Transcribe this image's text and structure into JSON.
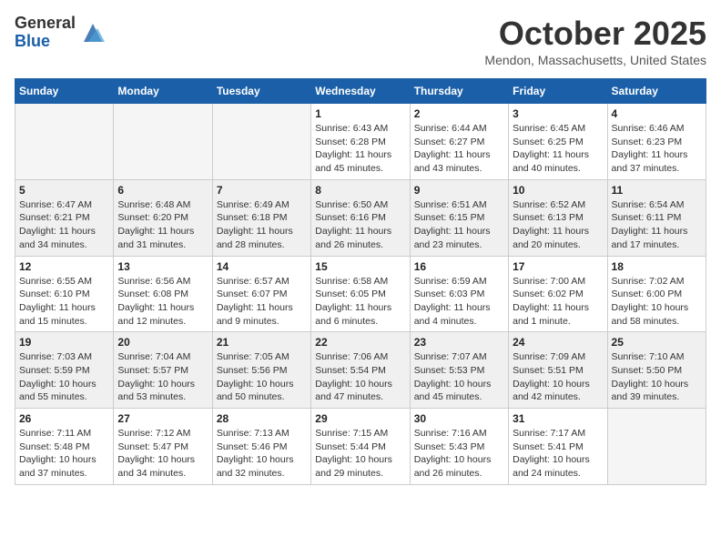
{
  "logo": {
    "general": "General",
    "blue": "Blue"
  },
  "title": "October 2025",
  "location": "Mendon, Massachusetts, United States",
  "weekdays": [
    "Sunday",
    "Monday",
    "Tuesday",
    "Wednesday",
    "Thursday",
    "Friday",
    "Saturday"
  ],
  "weeks": [
    [
      {
        "day": "",
        "info": ""
      },
      {
        "day": "",
        "info": ""
      },
      {
        "day": "",
        "info": ""
      },
      {
        "day": "1",
        "info": "Sunrise: 6:43 AM\nSunset: 6:28 PM\nDaylight: 11 hours\nand 45 minutes."
      },
      {
        "day": "2",
        "info": "Sunrise: 6:44 AM\nSunset: 6:27 PM\nDaylight: 11 hours\nand 43 minutes."
      },
      {
        "day": "3",
        "info": "Sunrise: 6:45 AM\nSunset: 6:25 PM\nDaylight: 11 hours\nand 40 minutes."
      },
      {
        "day": "4",
        "info": "Sunrise: 6:46 AM\nSunset: 6:23 PM\nDaylight: 11 hours\nand 37 minutes."
      }
    ],
    [
      {
        "day": "5",
        "info": "Sunrise: 6:47 AM\nSunset: 6:21 PM\nDaylight: 11 hours\nand 34 minutes."
      },
      {
        "day": "6",
        "info": "Sunrise: 6:48 AM\nSunset: 6:20 PM\nDaylight: 11 hours\nand 31 minutes."
      },
      {
        "day": "7",
        "info": "Sunrise: 6:49 AM\nSunset: 6:18 PM\nDaylight: 11 hours\nand 28 minutes."
      },
      {
        "day": "8",
        "info": "Sunrise: 6:50 AM\nSunset: 6:16 PM\nDaylight: 11 hours\nand 26 minutes."
      },
      {
        "day": "9",
        "info": "Sunrise: 6:51 AM\nSunset: 6:15 PM\nDaylight: 11 hours\nand 23 minutes."
      },
      {
        "day": "10",
        "info": "Sunrise: 6:52 AM\nSunset: 6:13 PM\nDaylight: 11 hours\nand 20 minutes."
      },
      {
        "day": "11",
        "info": "Sunrise: 6:54 AM\nSunset: 6:11 PM\nDaylight: 11 hours\nand 17 minutes."
      }
    ],
    [
      {
        "day": "12",
        "info": "Sunrise: 6:55 AM\nSunset: 6:10 PM\nDaylight: 11 hours\nand 15 minutes."
      },
      {
        "day": "13",
        "info": "Sunrise: 6:56 AM\nSunset: 6:08 PM\nDaylight: 11 hours\nand 12 minutes."
      },
      {
        "day": "14",
        "info": "Sunrise: 6:57 AM\nSunset: 6:07 PM\nDaylight: 11 hours\nand 9 minutes."
      },
      {
        "day": "15",
        "info": "Sunrise: 6:58 AM\nSunset: 6:05 PM\nDaylight: 11 hours\nand 6 minutes."
      },
      {
        "day": "16",
        "info": "Sunrise: 6:59 AM\nSunset: 6:03 PM\nDaylight: 11 hours\nand 4 minutes."
      },
      {
        "day": "17",
        "info": "Sunrise: 7:00 AM\nSunset: 6:02 PM\nDaylight: 11 hours\nand 1 minute."
      },
      {
        "day": "18",
        "info": "Sunrise: 7:02 AM\nSunset: 6:00 PM\nDaylight: 10 hours\nand 58 minutes."
      }
    ],
    [
      {
        "day": "19",
        "info": "Sunrise: 7:03 AM\nSunset: 5:59 PM\nDaylight: 10 hours\nand 55 minutes."
      },
      {
        "day": "20",
        "info": "Sunrise: 7:04 AM\nSunset: 5:57 PM\nDaylight: 10 hours\nand 53 minutes."
      },
      {
        "day": "21",
        "info": "Sunrise: 7:05 AM\nSunset: 5:56 PM\nDaylight: 10 hours\nand 50 minutes."
      },
      {
        "day": "22",
        "info": "Sunrise: 7:06 AM\nSunset: 5:54 PM\nDaylight: 10 hours\nand 47 minutes."
      },
      {
        "day": "23",
        "info": "Sunrise: 7:07 AM\nSunset: 5:53 PM\nDaylight: 10 hours\nand 45 minutes."
      },
      {
        "day": "24",
        "info": "Sunrise: 7:09 AM\nSunset: 5:51 PM\nDaylight: 10 hours\nand 42 minutes."
      },
      {
        "day": "25",
        "info": "Sunrise: 7:10 AM\nSunset: 5:50 PM\nDaylight: 10 hours\nand 39 minutes."
      }
    ],
    [
      {
        "day": "26",
        "info": "Sunrise: 7:11 AM\nSunset: 5:48 PM\nDaylight: 10 hours\nand 37 minutes."
      },
      {
        "day": "27",
        "info": "Sunrise: 7:12 AM\nSunset: 5:47 PM\nDaylight: 10 hours\nand 34 minutes."
      },
      {
        "day": "28",
        "info": "Sunrise: 7:13 AM\nSunset: 5:46 PM\nDaylight: 10 hours\nand 32 minutes."
      },
      {
        "day": "29",
        "info": "Sunrise: 7:15 AM\nSunset: 5:44 PM\nDaylight: 10 hours\nand 29 minutes."
      },
      {
        "day": "30",
        "info": "Sunrise: 7:16 AM\nSunset: 5:43 PM\nDaylight: 10 hours\nand 26 minutes."
      },
      {
        "day": "31",
        "info": "Sunrise: 7:17 AM\nSunset: 5:41 PM\nDaylight: 10 hours\nand 24 minutes."
      },
      {
        "day": "",
        "info": ""
      }
    ]
  ]
}
